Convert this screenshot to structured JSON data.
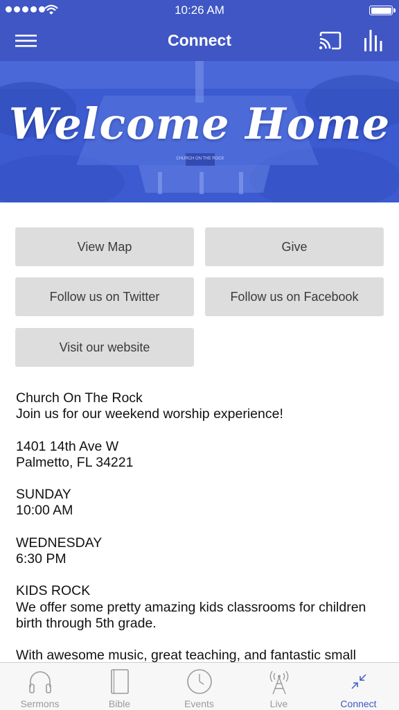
{
  "status_bar": {
    "time": "10:26 AM"
  },
  "nav": {
    "title": "Connect"
  },
  "hero": {
    "text": "Welcome Home",
    "sign_text": "CHURCH ON THE ROCK"
  },
  "buttons": {
    "view_map": "View Map",
    "give": "Give",
    "twitter": "Follow us on Twitter",
    "facebook": "Follow us on Facebook",
    "website": "Visit our website"
  },
  "content": {
    "intro_name": "Church On The Rock",
    "intro_tagline": "Join us for our weekend worship experience!",
    "address_line1": "1401 14th Ave W",
    "address_line2": "Palmetto, FL 34221",
    "sunday_label": "SUNDAY",
    "sunday_time": "10:00 AM",
    "wednesday_label": "WEDNESDAY",
    "wednesday_time": "6:30 PM",
    "kids_label": "KIDS ROCK",
    "kids_text": "We offer some pretty amazing kids classrooms for children birth through 5th grade.",
    "closing_text": "With awesome music, great teaching, and fantastic small"
  },
  "tabs": [
    {
      "label": "Sermons",
      "icon": "headphones-icon"
    },
    {
      "label": "Bible",
      "icon": "book-icon"
    },
    {
      "label": "Events",
      "icon": "clock-icon"
    },
    {
      "label": "Live",
      "icon": "broadcast-tower-icon"
    },
    {
      "label": "Connect",
      "icon": "connect-arrows-icon"
    }
  ],
  "colors": {
    "brand": "#3f56c4",
    "button_bg": "#dddddd",
    "tab_inactive": "#9a9a9a"
  }
}
